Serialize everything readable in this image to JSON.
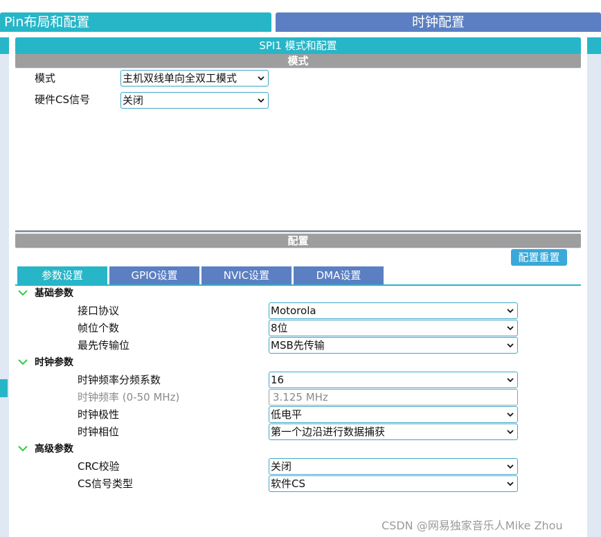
{
  "top_tabs": {
    "pin": "Pin布局和配置",
    "clock": "时钟配置"
  },
  "panel": {
    "title": "SPI1 模式和配置",
    "mode_section": "模式",
    "config_section": "配置",
    "mode_fields": [
      {
        "label": "模式",
        "value": "主机双线单向全双工模式"
      },
      {
        "label": "硬件CS信号",
        "value": "关闭"
      }
    ],
    "reset_button": "配置重置",
    "tabs": [
      "参数设置",
      "GPIO设置",
      "NVIC设置",
      "DMA设置"
    ],
    "groups": [
      {
        "name": "基础参数",
        "params": [
          {
            "label": "接口协议",
            "value": "Motorola"
          },
          {
            "label": "帧位个数",
            "value": "8位"
          },
          {
            "label": "最先传输位",
            "value": "MSB先传输"
          }
        ]
      },
      {
        "name": "时钟参数",
        "params": [
          {
            "label": "时钟频率分频系数",
            "value": "16"
          },
          {
            "label": "时钟频率",
            "label_suffix": "(0-50 MHz)",
            "value": "3.125 MHz",
            "readonly": true
          },
          {
            "label": "时钟极性",
            "value": "低电平"
          },
          {
            "label": "时钟相位",
            "value": "第一个边沿进行数据捕获"
          }
        ]
      },
      {
        "name": "高级参数",
        "params": [
          {
            "label": "CRC校验",
            "value": "关闭"
          },
          {
            "label": "CS信号类型",
            "value": "软件CS"
          }
        ]
      }
    ]
  },
  "watermark": "CSDN @网易独家音乐人Mike Zhou",
  "colors": {
    "teal": "#26b6c8",
    "blue": "#5b7fc2",
    "button_blue": "#3aa8d8",
    "section_gray": "#9e9e9e",
    "chevron_green": "#2ecc40"
  }
}
